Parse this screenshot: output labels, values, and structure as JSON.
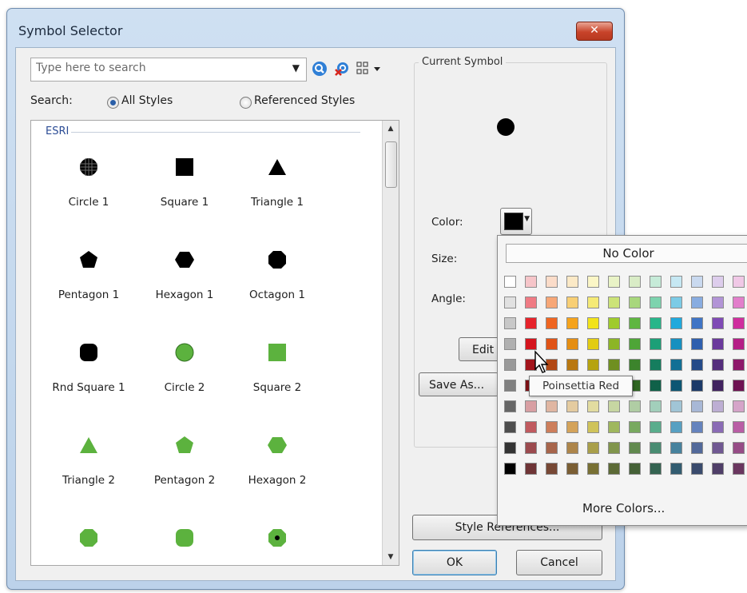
{
  "window": {
    "title": "Symbol Selector",
    "close_label": "✕"
  },
  "search": {
    "placeholder": "Type here to search",
    "label": "Search:",
    "options": [
      {
        "label": "All Styles",
        "selected": true
      },
      {
        "label": "Referenced Styles",
        "selected": false
      }
    ]
  },
  "list": {
    "group": "ESRI",
    "symbols": [
      {
        "label": "Circle 1",
        "shape": "grid-circle",
        "color": "#000000"
      },
      {
        "label": "Square 1",
        "shape": "square",
        "color": "#000000"
      },
      {
        "label": "Triangle 1",
        "shape": "triangle",
        "color": "#000000"
      },
      {
        "label": "Pentagon 1",
        "shape": "pentagon",
        "color": "#000000"
      },
      {
        "label": "Hexagon 1",
        "shape": "hexagon",
        "color": "#000000"
      },
      {
        "label": "Octagon 1",
        "shape": "octagon",
        "color": "#000000"
      },
      {
        "label": "Rnd Square 1",
        "shape": "round-square",
        "color": "#000000"
      },
      {
        "label": "Circle 2",
        "shape": "circle",
        "color": "#5cb23e"
      },
      {
        "label": "Square 2",
        "shape": "square",
        "color": "#5cb23e"
      },
      {
        "label": "Triangle 2",
        "shape": "triangle",
        "color": "#5cb23e"
      },
      {
        "label": "Pentagon 2",
        "shape": "pentagon",
        "color": "#5cb23e"
      },
      {
        "label": "Hexagon 2",
        "shape": "hexagon",
        "color": "#5cb23e"
      },
      {
        "label": "",
        "shape": "octagon",
        "color": "#5cb23e"
      },
      {
        "label": "",
        "shape": "round-square",
        "color": "#5cb23e"
      },
      {
        "label": "",
        "shape": "dot-circle",
        "color": "#5cb23e"
      }
    ]
  },
  "current": {
    "caption": "Current Symbol",
    "color_label": "Color:",
    "size_label": "Size:",
    "angle_label": "Angle:",
    "edit_label": "Edit S",
    "save_as_label": "Save As...",
    "style_references_label": "Style References...",
    "ok_label": "OK",
    "cancel_label": "Cancel",
    "current_color": "#000000"
  },
  "color_popup": {
    "no_color_label": "No Color",
    "more_colors_label": "More Colors...",
    "tooltip": "Poinsettia Red",
    "rows": [
      [
        "#ffffff",
        "#f6c5c9",
        "#fbdcc9",
        "#fbe9c6",
        "#fbf6c6",
        "#e9f3c6",
        "#d9ecc6",
        "#c6ebd8",
        "#c6e8f3",
        "#c9d9ef",
        "#ddcdec",
        "#f0c8e6"
      ],
      [
        "#e1e1e1",
        "#ef7b84",
        "#f7a777",
        "#f8cf75",
        "#f5ea76",
        "#cce378",
        "#a8d77c",
        "#7dd3ae",
        "#7ccbe6",
        "#88ace0",
        "#b294d6",
        "#e27fcb"
      ],
      [
        "#c8c8c8",
        "#e6232b",
        "#ef6521",
        "#f5a31c",
        "#f2e31a",
        "#9fcb2c",
        "#5fb640",
        "#27b68a",
        "#20a9dc",
        "#3f74c5",
        "#7f4ab5",
        "#cf2e9e"
      ],
      [
        "#b0b0b0",
        "#d4141d",
        "#e05316",
        "#e58e12",
        "#e2cc12",
        "#8cb526",
        "#4ea537",
        "#1c9f77",
        "#1790c0",
        "#2f5fae",
        "#6a399c",
        "#b51e86"
      ],
      [
        "#999999",
        "#a3141b",
        "#b24714",
        "#b97710",
        "#b6a30f",
        "#6f8f20",
        "#3c842c",
        "#157d5e",
        "#116f95",
        "#244a88",
        "#542d7c",
        "#8e176a"
      ],
      [
        "#808080",
        "#7d1015",
        "#8a370f",
        "#8f5c0c",
        "#8d7e0b",
        "#566f19",
        "#2f6622",
        "#106149",
        "#0d5673",
        "#1c3a69",
        "#412360",
        "#6e1252"
      ],
      [
        "#666666",
        "#d89fa3",
        "#e0b6a2",
        "#e4cba0",
        "#e2dca0",
        "#c7d6a2",
        "#b0cda4",
        "#a2cfbb",
        "#a1c5d6",
        "#a8b8d6",
        "#bdaed3",
        "#d5a4c9"
      ],
      [
        "#4d4d4d",
        "#c05a5f",
        "#cd7e5b",
        "#d4a35a",
        "#cfc35a",
        "#9fb75d",
        "#78a95f",
        "#59ad8c",
        "#57a0c2",
        "#6583bd",
        "#8a6bb5",
        "#b95ea5"
      ],
      [
        "#333333",
        "#9b4a4e",
        "#a7654b",
        "#ad854a",
        "#a99f4a",
        "#81954c",
        "#61894e",
        "#498c72",
        "#47829d",
        "#52699a",
        "#705892",
        "#964c86"
      ],
      [
        "#000000",
        "#6e3436",
        "#774835",
        "#7a5e34",
        "#787034",
        "#5c6a36",
        "#456137",
        "#346351",
        "#325c70",
        "#3a4b6d",
        "#4f3e68",
        "#6a365f"
      ]
    ]
  }
}
